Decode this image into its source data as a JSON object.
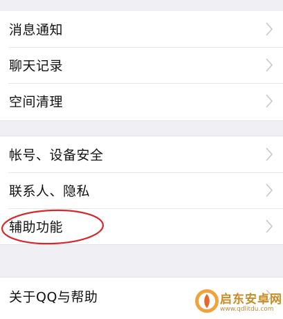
{
  "settings_groups": [
    {
      "items": [
        {
          "label": "消息通知",
          "chevron": "chevron-right-icon"
        },
        {
          "label": "聊天记录",
          "chevron": "chevron-right-icon"
        },
        {
          "label": "空间清理",
          "chevron": "chevron-right-icon"
        }
      ]
    },
    {
      "items": [
        {
          "label": "帐号、设备安全",
          "chevron": "chevron-right-icon"
        },
        {
          "label": "联系人、隐私",
          "chevron": "chevron-right-icon"
        },
        {
          "label": "辅助功能",
          "chevron": "chevron-right-icon",
          "highlighted": true
        }
      ]
    },
    {
      "items": [
        {
          "label": "关于QQ与帮助",
          "chevron": "chevron-right-icon"
        }
      ]
    }
  ],
  "annotation": {
    "shape": "ellipse",
    "color": "#d8262b",
    "target": "辅助功能"
  },
  "watermark": {
    "name": "启东安卓网",
    "url": "www.qdlitdu.com",
    "color": "#c98a22"
  },
  "colors": {
    "background": "#efeff4",
    "row": "#ffffff",
    "text": "#111111",
    "chevron": "#c7c7cc"
  }
}
